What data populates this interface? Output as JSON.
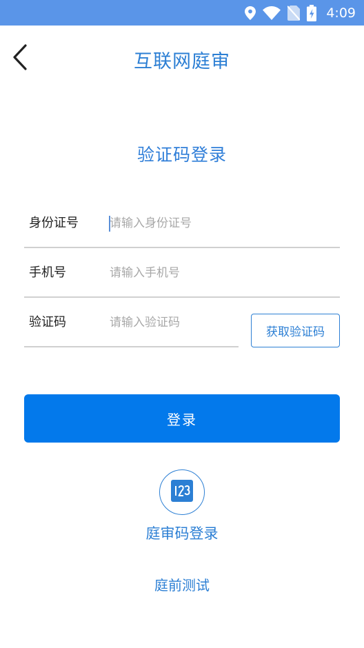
{
  "status_bar": {
    "time": "4:09",
    "icons": [
      "location-icon",
      "wifi-icon",
      "no-sim-icon",
      "battery-charging-icon"
    ]
  },
  "header": {
    "title": "互联网庭审",
    "back_icon": "chevron-left-icon"
  },
  "page_title": "验证码登录",
  "form": {
    "id_label": "身份证号",
    "id_placeholder": "请输入身份证号",
    "id_value": "",
    "phone_label": "手机号",
    "phone_placeholder": "请输入手机号",
    "phone_value": "",
    "code_label": "验证码",
    "code_placeholder": "请输入验证码",
    "code_value": "",
    "get_code_label": "获取验证码"
  },
  "login_label": "登录",
  "court_code": {
    "icon": "number-123-icon",
    "label": "庭审码登录"
  },
  "pretrial_test_label": "庭前测试",
  "colors": {
    "status_bar": "#5a95e8",
    "accent": "#2c7fd4",
    "primary_button": "#0379eb"
  }
}
